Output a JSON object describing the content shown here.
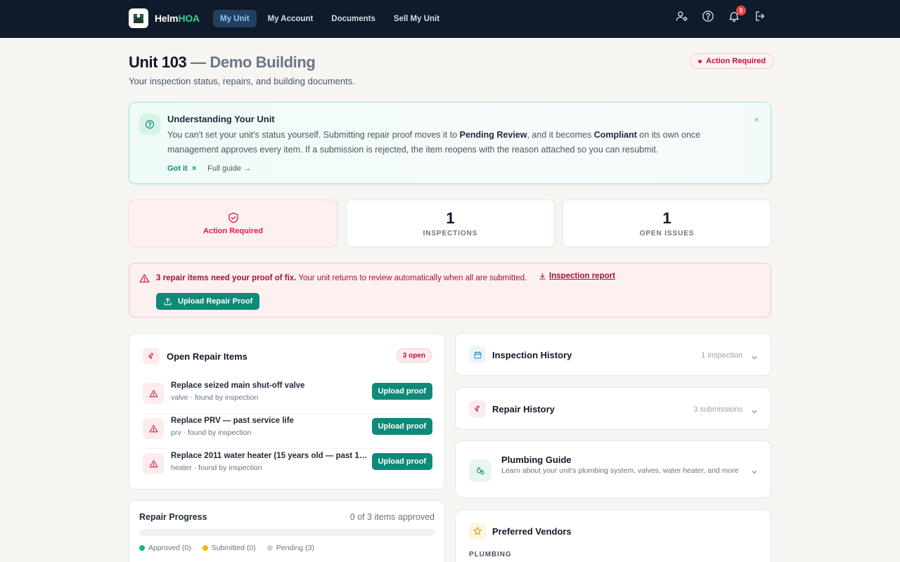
{
  "app": {
    "brand_main": "Helm",
    "brand_accent": "HOA"
  },
  "nav": {
    "items": [
      {
        "label": "My Unit",
        "active": true
      },
      {
        "label": "My Account",
        "active": false
      },
      {
        "label": "Documents",
        "active": false
      },
      {
        "label": "Sell My Unit",
        "active": false
      }
    ],
    "notification_count": "5"
  },
  "header": {
    "unit": "Unit 103",
    "building": "— Demo Building",
    "subtitle": "Your inspection status, repairs, and building documents.",
    "status": "Action Required"
  },
  "info": {
    "title": "Understanding Your Unit",
    "body_1": "You can't set your unit's status yourself. Submitting repair proof moves it to ",
    "body_bold_1": "Pending Review",
    "body_2": ", and it becomes ",
    "body_bold_2": "Compliant",
    "body_3": " on its own once management approves every item. If a submission is rejected, the item reopens with the reason attached so you can resubmit.",
    "got_it": "Got it",
    "got_it_x": "×",
    "full_guide": "Full guide →",
    "close": "×"
  },
  "stats": {
    "status_label": "Action Required",
    "inspections_value": "1",
    "inspections_label": "INSPECTIONS",
    "issues_value": "1",
    "issues_label": "OPEN ISSUES"
  },
  "alert": {
    "bold": "3 repair items need your proof of fix.",
    "text": " Your unit returns to review automatically when all are submitted.",
    "link": "Inspection report",
    "button": "Upload Repair Proof"
  },
  "repairs": {
    "title": "Open Repair Items",
    "count_badge": "3 open",
    "items": [
      {
        "title": "Replace seized main shut-off valve",
        "sub": "valve · found by inspection",
        "button": "Upload proof"
      },
      {
        "title": "Replace PRV — past service life",
        "sub": "prv · found by inspection",
        "button": "Upload proof"
      },
      {
        "title": "Replace 2011 water heater (15 years old — past 12...",
        "sub": "heater · found by inspection",
        "button": "Upload proof"
      }
    ]
  },
  "progress": {
    "title": "Repair Progress",
    "count": "0 of 3 items approved",
    "fraction_approved": 0,
    "legend": [
      {
        "label": "Approved (0)",
        "color": "#10b981"
      },
      {
        "label": "Submitted (0)",
        "color": "#f5b60b"
      },
      {
        "label": "Pending (3)",
        "color": "#d1d5db"
      }
    ]
  },
  "side": {
    "inspection_history": {
      "title": "Inspection History",
      "meta": "1 inspection"
    },
    "repair_history": {
      "title": "Repair History",
      "meta": "3 submissions"
    },
    "plumbing_guide": {
      "title": "Plumbing Guide",
      "sub": "Learn about your unit's plumbing system, valves, water heater, and more"
    },
    "preferred_vendors": {
      "title": "Preferred Vendors",
      "category": "PLUMBING"
    }
  },
  "colors": {
    "nav_bg": "#0f1b2a",
    "accent_teal": "#0f8a78",
    "alert_red": "#e11d48"
  }
}
